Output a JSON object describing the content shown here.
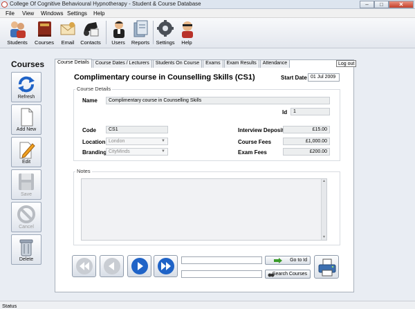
{
  "window": {
    "title": "College Of Cognitive Behavioural Hypnotherapy - Student & Course Database",
    "min": "–",
    "max": "□",
    "close": "✕"
  },
  "menu": [
    "File",
    "View",
    "Windows",
    "Settings",
    "Help"
  ],
  "toolbar": [
    {
      "label": "Students",
      "icon": "students-icon"
    },
    {
      "label": "Courses",
      "icon": "courses-icon"
    },
    {
      "label": "Email",
      "icon": "email-icon"
    },
    {
      "label": "Contacts",
      "icon": "contacts-icon"
    },
    {
      "label": "Users",
      "icon": "users-icon"
    },
    {
      "label": "Reports",
      "icon": "reports-icon"
    },
    {
      "label": "Settings",
      "icon": "settings-icon"
    },
    {
      "label": "Help",
      "icon": "help-icon"
    }
  ],
  "sidebar": {
    "heading": "Courses",
    "buttons": [
      {
        "label": "Refresh",
        "icon": "refresh-icon",
        "enabled": true
      },
      {
        "label": "Add New",
        "icon": "new-document-icon",
        "enabled": true
      },
      {
        "label": "Edit",
        "icon": "edit-pencil-icon",
        "enabled": true
      },
      {
        "label": "Save",
        "icon": "save-disk-icon",
        "enabled": false
      },
      {
        "label": "Cancel",
        "icon": "cancel-icon",
        "enabled": false
      },
      {
        "label": "Delete",
        "icon": "trash-icon",
        "enabled": true
      }
    ]
  },
  "tabs": [
    {
      "label": "Course Details",
      "active": true
    },
    {
      "label": "Course Dates / Lecturers",
      "active": false
    },
    {
      "label": "Students On Course",
      "active": false
    },
    {
      "label": "Exams",
      "active": false
    },
    {
      "label": "Exam Results",
      "active": false
    },
    {
      "label": "Attendance",
      "active": false
    }
  ],
  "logout_label": "Log out",
  "course": {
    "title": "Complimentary course in Counselling Skills (CS1)",
    "start_date_label": "Start Date",
    "start_date": "01 Jul 2009",
    "section_label": "Course Details",
    "name_label": "Name",
    "name": "Complimentary course in Counselling Skills",
    "id_label": "Id",
    "id": "1",
    "code_label": "Code",
    "code": "CS1",
    "location_label": "Location",
    "location": "London",
    "branding_label": "Branding",
    "branding": "CityMinds",
    "deposit_label": "Interview Deposit",
    "deposit": "£15.00",
    "fees_label": "Course Fees",
    "fees": "£1,000.00",
    "exam_fees_label": "Exam Fees",
    "exam_fees": "£200.00",
    "notes_label": "Notes"
  },
  "actions": {
    "goto_label": "Go to Id",
    "search_label": "Search Courses"
  },
  "status": "Status",
  "colors": {
    "accent": "#1f63c7",
    "nav_disabled": "#c9cdd3",
    "goto_arrow": "#3a9a2a"
  }
}
